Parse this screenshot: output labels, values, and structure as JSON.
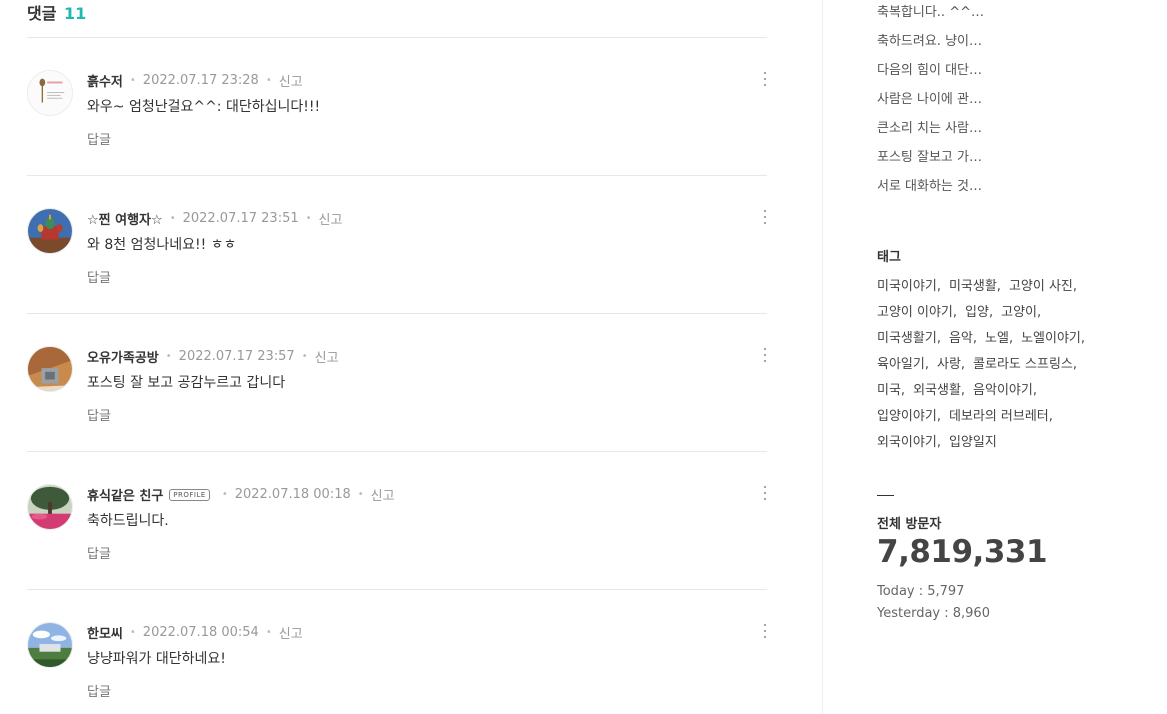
{
  "comments_section": {
    "title": "댓글",
    "count": "11",
    "comments": [
      {
        "author": "흙수저",
        "date": "2022.07.17 23:28",
        "report_label": "신고",
        "text": "와우~ 엄청난걸요^^: 대단하십니다!!!",
        "reply_label": "답글",
        "avatar_icon": "spoon-logo-avatar"
      },
      {
        "author": "☆찐 여행자☆",
        "date": "2022.07.17 23:51",
        "report_label": "신고",
        "text": "와 8천 엄청나네요!! ㅎㅎ",
        "reply_label": "답글",
        "avatar_icon": "cathedral-photo-avatar"
      },
      {
        "author": "오유가족공방",
        "date": "2022.07.17 23:57",
        "report_label": "신고",
        "text": "포스팅 잘 보고 공감누르고 갑니다",
        "reply_label": "답글",
        "avatar_icon": "wood-craft-avatar"
      },
      {
        "author": "휴식같은 친구",
        "badge": "PROFILE",
        "date": "2022.07.18 00:18",
        "report_label": "신고",
        "text": "축하드립니다.",
        "reply_label": "답글",
        "avatar_icon": "tree-flowers-avatar"
      },
      {
        "author": "한모씨",
        "date": "2022.07.18 00:54",
        "report_label": "신고",
        "text": "냥냥파워가 대단하네요!",
        "reply_label": "답글",
        "avatar_icon": "landscape-avatar"
      }
    ]
  },
  "sidebar": {
    "recent_comments": [
      "축복합니다.. ^^…",
      "축하드려요. 냥이…",
      "다음의 힘이 대단…",
      "사람은 나이에 관…",
      "큰소리 치는 사람…",
      "포스팅 잘보고 가…",
      "서로 대화하는 것…"
    ],
    "tags_title": "태그",
    "tags": [
      "미국이야기",
      "미국생활",
      "고양이 사진",
      "고양이 이야기",
      "입양",
      "고양이",
      "미국생활기",
      "음악",
      "노엘",
      "노엘이야기",
      "육아일기",
      "사랑",
      "콜로라도 스프링스",
      "미국",
      "외국생활",
      "음악이야기",
      "입양이야기",
      "데보라의 러브레터",
      "외국이야기",
      "입양일지"
    ],
    "visitors": {
      "title": "전체 방문자",
      "total": "7,819,331",
      "today": "Today : 5,797",
      "yesterday": "Yesterday : 8,960"
    }
  },
  "colors": {
    "accent": "#21b8b0",
    "text": "#333333",
    "muted": "#999999",
    "divider": "#e8e8e8"
  }
}
